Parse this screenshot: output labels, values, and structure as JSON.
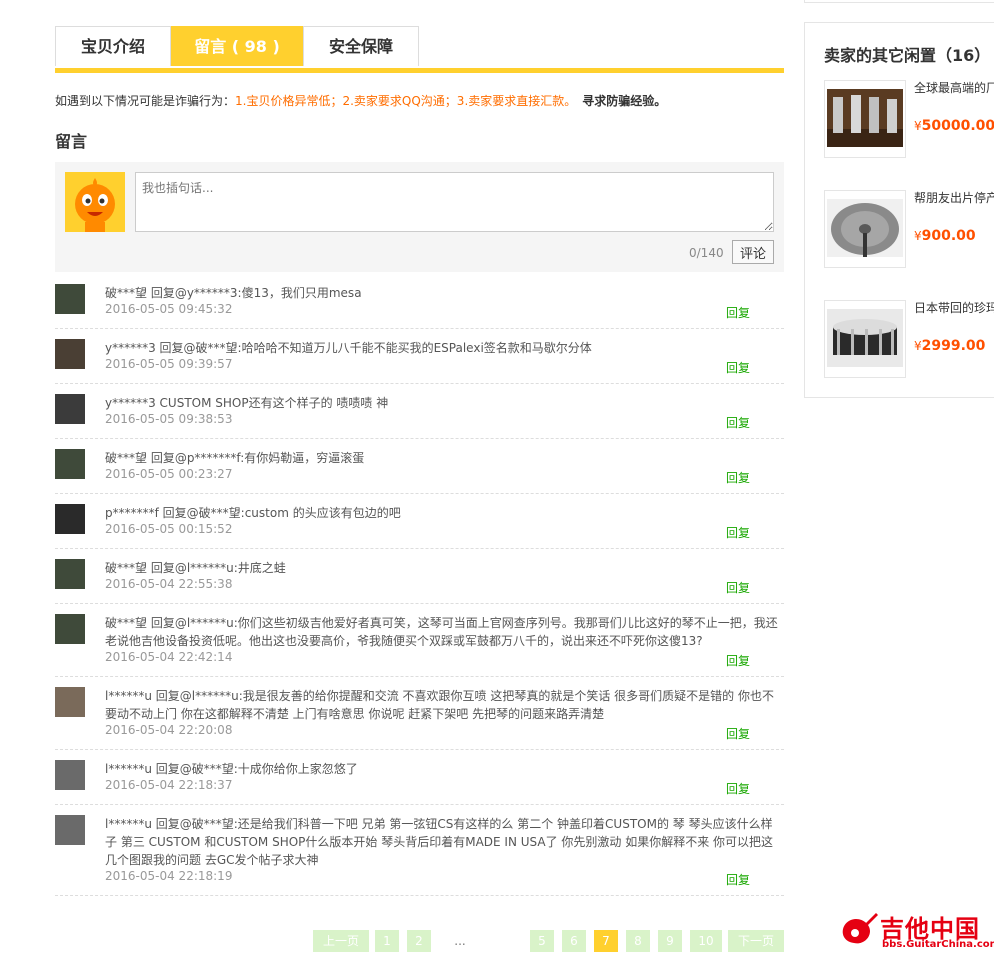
{
  "tabs": [
    {
      "label": "宝贝介绍"
    },
    {
      "label": "留言 ( 98 )"
    },
    {
      "label": "安全保障"
    }
  ],
  "warning": {
    "prefix": "如遇到以下情况可能是诈骗行为：",
    "items": "1.宝贝价格异常低；2.卖家要求QQ沟通；3.卖家要求直接汇款。",
    "link": "寻求防骗经验。"
  },
  "section_title": "留言",
  "compose": {
    "placeholder": "我也插句话...",
    "counter": "0/140",
    "submit_label": "评论"
  },
  "reply_label": "回复",
  "comments": [
    {
      "text": "破***望   回复@y******3:傻13，我们只用mesa",
      "time": "2016-05-05 09:45:32"
    },
    {
      "text": "y******3   回复@破***望:哈哈哈不知道万儿八千能不能买我的ESPalexi签名款和马歇尔分体",
      "time": "2016-05-05 09:39:57"
    },
    {
      "text": "y******3   CUSTOM SHOP还有这个样子的 啧啧啧 神",
      "time": "2016-05-05 09:38:53"
    },
    {
      "text": "破***望   回复@p*******f:有你妈勒逼，穷逼滚蛋",
      "time": "2016-05-05 00:23:27"
    },
    {
      "text": "p*******f   回复@破***望:custom 的头应该有包边的吧",
      "time": "2016-05-05 00:15:52"
    },
    {
      "text": "破***望   回复@l******u:井底之蛙",
      "time": "2016-05-04 22:55:38"
    },
    {
      "text": "破***望   回复@l******u:你们这些初级吉他爱好者真可笑，这琴可当面上官网查序列号。我那哥们儿比这好的琴不止一把，我还老说他吉他设备投资低呢。他出这也没要高价，爷我随便买个双踩或军鼓都万八千的，说出来还不吓死你这傻13?",
      "time": "2016-05-04 22:42:14"
    },
    {
      "text": "l******u   回复@l******u:我是很友善的给你提醒和交流 不喜欢跟你互喷 这把琴真的就是个笑话 很多哥们质疑不是错的 你也不要动不动上门 你在这都解释不清楚 上门有啥意思 你说呢 赶紧下架吧 先把琴的问题来路弄清楚",
      "time": "2016-05-04 22:20:08"
    },
    {
      "text": "l******u   回复@破***望:十成你给你上家忽悠了",
      "time": "2016-05-04 22:18:37"
    },
    {
      "text": "l******u   回复@破***望:还是给我们科普一下吧 兄弟 第一弦钮CS有这样的么 第二个 钟盖印着CUSTOM的 琴 琴头应该什么样子 第三 CUSTOM 和CUSTOM SHOP什么版本开始 琴头背后印着有MADE IN USA了 你先别激动 如果你解释不来 你可以把这几个图跟我的问题 去GC发个帖子求大神",
      "time": "2016-05-04 22:18:19"
    }
  ],
  "pagination": {
    "prev": "上一页",
    "pages": [
      "1",
      "2",
      "...",
      "5",
      "6",
      "7",
      "8",
      "9",
      "10"
    ],
    "current": "7",
    "next": "下一页"
  },
  "sidebar": {
    "title": "卖家的其它闲置（16）",
    "items": [
      {
        "title": "全球最高端的厂 双踩 9成新以上",
        "price": "50000.00"
      },
      {
        "title": "帮朋友出片停产 音镲 9成新以上",
        "price": "900.00"
      },
      {
        "title": "日本带回的珍玛 Pearl大师录音军",
        "price": "2999.00"
      }
    ],
    "currency": "¥"
  },
  "watermark": {
    "cn": "吉他中国",
    "en": "bbs.GuitarChina.com"
  }
}
